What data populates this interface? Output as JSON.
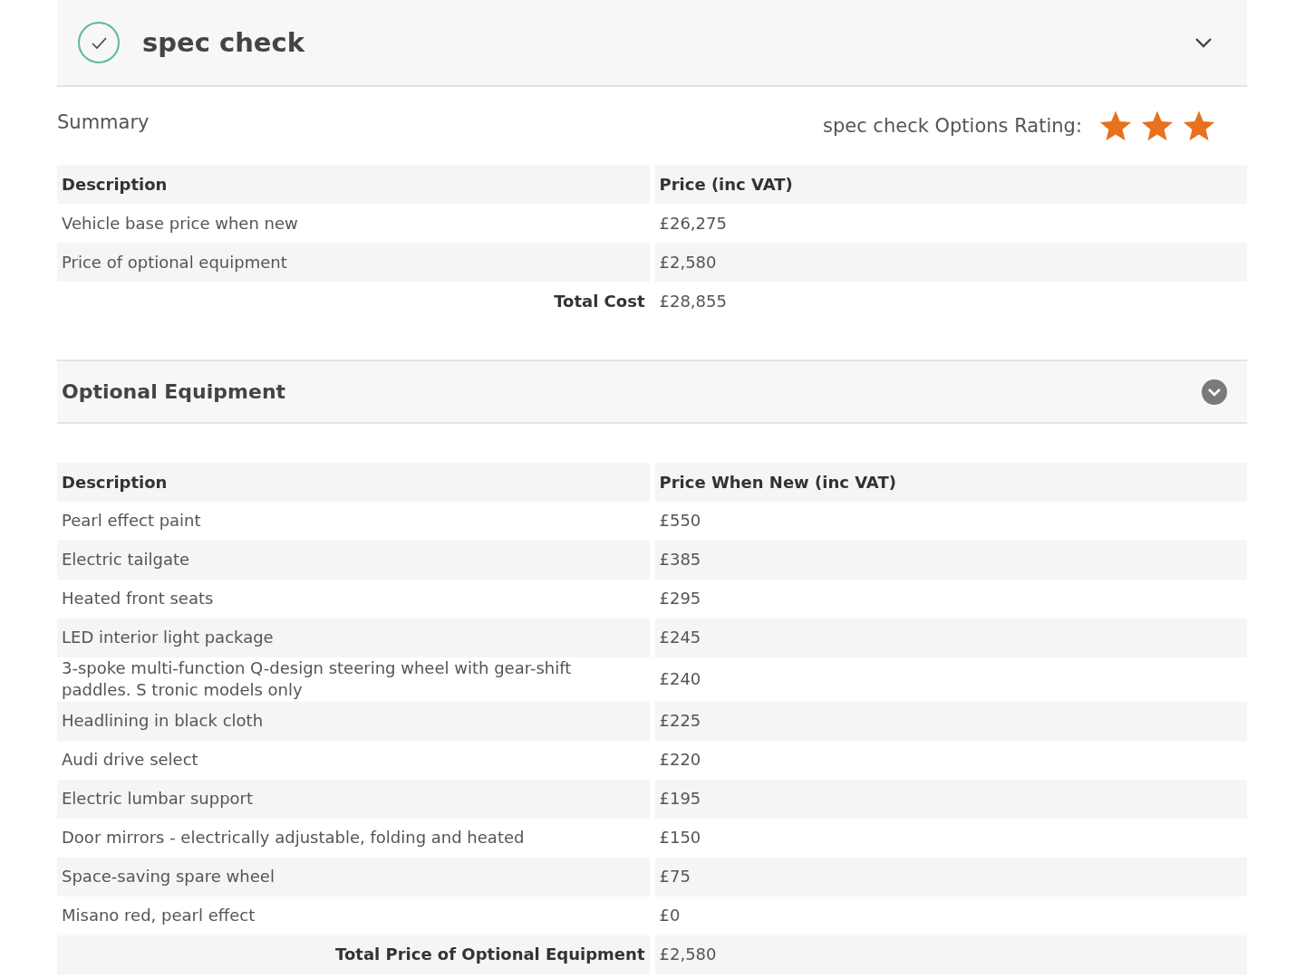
{
  "header": {
    "title": "spec check",
    "checked": true,
    "expanded": true
  },
  "summary": {
    "title": "Summary",
    "rating_label": "spec check Options Rating:",
    "stars": 3,
    "columns": [
      "Description",
      "Price (inc VAT)"
    ],
    "rows": [
      {
        "description": "Vehicle base price when new",
        "price": "£26,275"
      },
      {
        "description": "Price of optional equipment",
        "price": "£2,580"
      }
    ],
    "total": {
      "label": "Total Cost",
      "price": "£28,855"
    }
  },
  "optional": {
    "title": "Optional Equipment",
    "expanded": true,
    "columns": [
      "Description",
      "Price When New (inc VAT)"
    ],
    "rows": [
      {
        "description": "Pearl effect paint",
        "price": "£550"
      },
      {
        "description": "Electric tailgate",
        "price": "£385"
      },
      {
        "description": "Heated front seats",
        "price": "£295"
      },
      {
        "description": "LED interior light package",
        "price": "£245"
      },
      {
        "description": "3-spoke multi-function Q-design steering wheel with gear-shift paddles. S tronic models only",
        "price": "£240"
      },
      {
        "description": "Headlining in black cloth",
        "price": "£225"
      },
      {
        "description": "Audi drive select",
        "price": "£220"
      },
      {
        "description": "Electric lumbar support",
        "price": "£195"
      },
      {
        "description": "Door mirrors - electrically adjustable, folding and heated",
        "price": "£150"
      },
      {
        "description": "Space-saving spare wheel",
        "price": "£75"
      },
      {
        "description": "Misano red, pearl effect",
        "price": "£0"
      }
    ],
    "total": {
      "label": "Total Price of Optional Equipment",
      "price": "£2,580"
    }
  }
}
